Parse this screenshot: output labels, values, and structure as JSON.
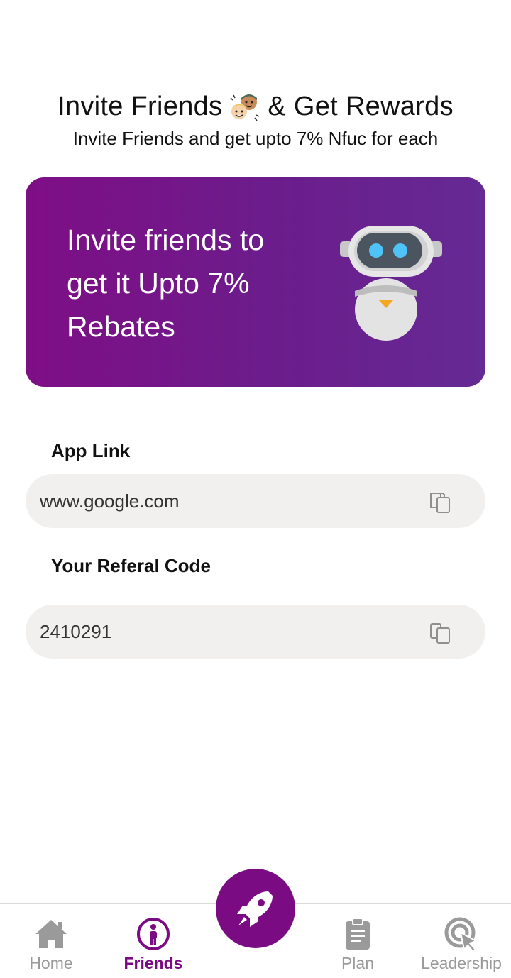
{
  "header": {
    "title_part1": "Invite Friends",
    "title_emoji": "friends-emoji-icon",
    "title_part2": "& Get Rewards",
    "subtitle": "Invite Friends and get upto 7% Nfuc for each"
  },
  "banner": {
    "line1": "Invite friends to",
    "line2": "get it Upto 7%",
    "line3": "Rebates",
    "image": "robot-icon",
    "gradient_start": "#7f0e85",
    "gradient_end": "#652a94"
  },
  "app_link": {
    "label": "App Link",
    "value": "www.google.com",
    "copy_icon": "copy-icon"
  },
  "referral": {
    "label": "Your Referal Code",
    "value": "2410291",
    "copy_icon": "copy-icon"
  },
  "nav": {
    "accent": "#7b0b82",
    "inactive_color": "#9a9a9a",
    "items": [
      {
        "label": "Home",
        "icon": "home-icon",
        "active": false
      },
      {
        "label": "Friends",
        "icon": "friend-person-icon",
        "active": true
      },
      {
        "label": "Plan",
        "icon": "clipboard-icon",
        "active": false
      },
      {
        "label": "Leadership",
        "icon": "cursor-click-icon",
        "active": false
      }
    ],
    "fab_icon": "rocket-icon"
  }
}
